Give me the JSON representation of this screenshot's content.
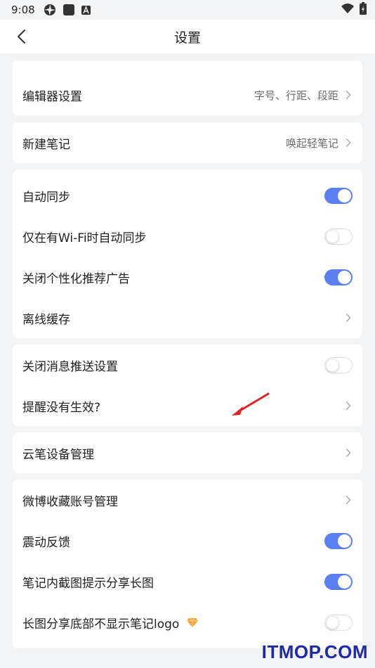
{
  "status_bar": {
    "time": "9:08",
    "icons": [
      "aperture-icon",
      "square-icon",
      "font-a-icon"
    ],
    "right_icons": [
      "wifi-icon",
      "battery-icon"
    ]
  },
  "header": {
    "title": "设置"
  },
  "settings": {
    "editor": {
      "label": "编辑器设置",
      "value": "字号、行距、段距"
    },
    "new_note": {
      "label": "新建笔记",
      "value": "唤起轻笔记"
    },
    "auto_sync": {
      "label": "自动同步",
      "on": true
    },
    "wifi_sync": {
      "label": "仅在有Wi-Fi时自动同步",
      "on": false
    },
    "close_ads": {
      "label": "关闭个性化推荐广告",
      "on": true
    },
    "offline_cache": {
      "label": "离线缓存"
    },
    "close_push": {
      "label": "关闭消息推送设置",
      "on": false
    },
    "reminder": {
      "label": "提醒没有生效?"
    },
    "pen_device": {
      "label": "云笔设备管理"
    },
    "weibo": {
      "label": "微博收藏账号管理"
    },
    "vibration": {
      "label": "震动反馈",
      "on": true
    },
    "screenshot_share": {
      "label": "笔记内截图提示分享长图",
      "on": true
    },
    "hide_logo": {
      "label": "长图分享底部不显示笔记logo",
      "on": false
    }
  },
  "watermark": "ITMOP.COM",
  "colors": {
    "toggle_on": "#5b7ff0",
    "arrow": "#e0222b",
    "diamond": "#f2a23a",
    "watermark": "#1f2aa8"
  }
}
